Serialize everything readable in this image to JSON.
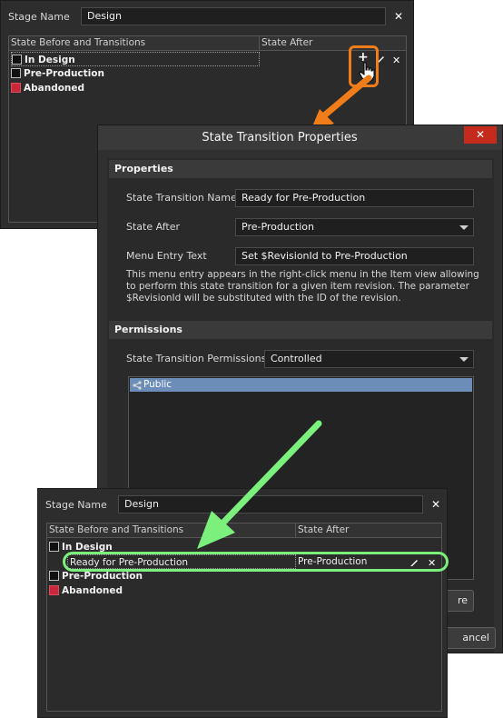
{
  "top_panel": {
    "stage_label": "Stage Name",
    "stage_value": "Design",
    "col_state_before": "State Before and Transitions",
    "col_state_after": "State After",
    "rows": [
      {
        "label": "In Design"
      },
      {
        "label": "Pre-Production"
      },
      {
        "label": "Abandoned"
      }
    ]
  },
  "dialog": {
    "title": "State Transition Properties",
    "properties_header": "Properties",
    "transition_name_label": "State Transition Name",
    "transition_name_value": "Ready for Pre-Production",
    "state_after_label": "State After",
    "state_after_value": "Pre-Production",
    "menu_entry_label": "Menu Entry Text",
    "menu_entry_value": "Set $RevisionId to Pre-Production",
    "hint_line_1": "This menu entry appears in the right-click menu in the Item view allowing",
    "hint_line_2": "to perform this state transition for a given item revision. The parameter",
    "hint_line_3": "$RevisionId will be substituted with the ID of the revision.",
    "permissions_header": "Permissions",
    "permissions_label": "State Transition Permissions",
    "permissions_value": "Controlled",
    "permission_items": [
      "Public"
    ],
    "partial_button_text": "re",
    "cancel_partial_text": "ancel"
  },
  "bottom_panel": {
    "stage_label": "Stage Name",
    "stage_value": "Design",
    "col_state_before": "State Before and Transitions",
    "col_state_after": "State After",
    "row_in_design": "In Design",
    "transition_label": "Ready for Pre-Production",
    "transition_after": "Pre-Production",
    "row_pre_production": "Pre-Production",
    "row_abandoned": "Abandoned"
  },
  "colors": {
    "highlight_orange": "#f07d1a",
    "highlight_green": "#7cf07c",
    "dialog_close_red": "#c42b1c",
    "abandoned_red": "#c9273a",
    "selection_blue": "#6b8db8"
  },
  "icons": [
    "plus-icon",
    "hand-cursor-icon",
    "pencil-icon",
    "close-icon",
    "share-icon",
    "dropdown-arrow-icon"
  ]
}
